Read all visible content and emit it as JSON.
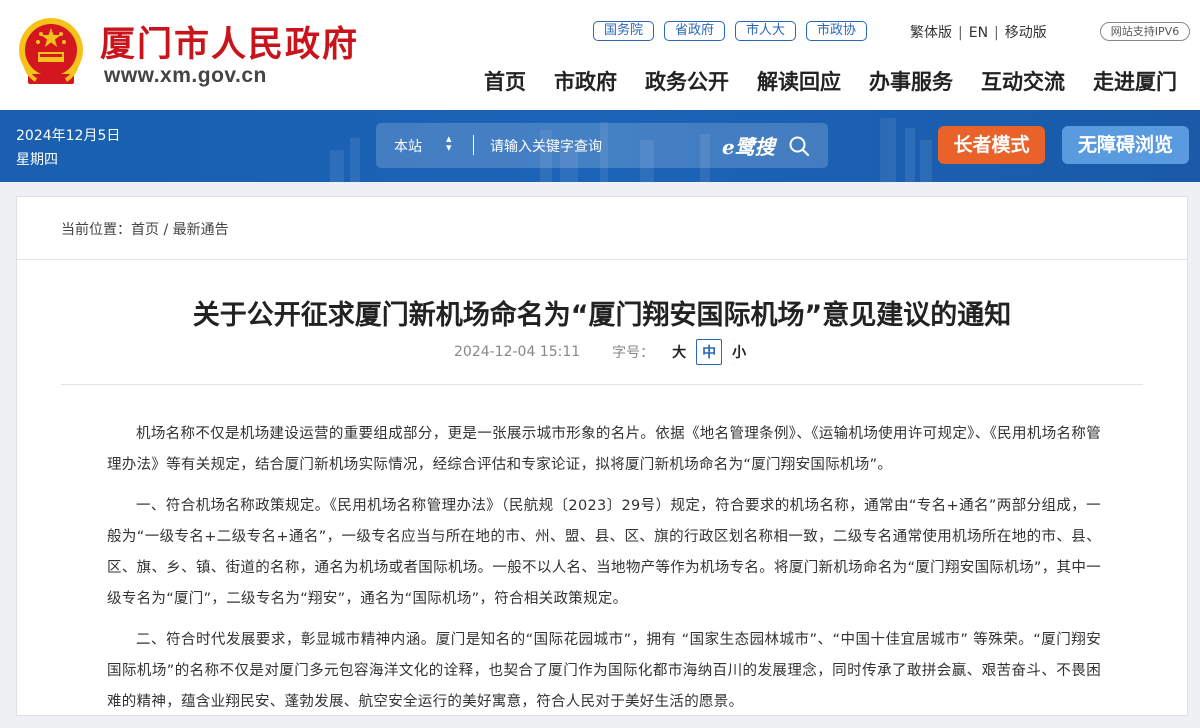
{
  "header": {
    "site_name": "厦门市人民政府",
    "site_url": "www.xm.gov.cn",
    "gov_links": [
      "国务院",
      "省政府",
      "市人大",
      "市政协"
    ],
    "lang_links": [
      "繁体版",
      "EN",
      "移动版"
    ],
    "ipv6": "网站支持IPV6",
    "nav": [
      "首页",
      "市政府",
      "政务公开",
      "解读回应",
      "办事服务",
      "互动交流",
      "走进厦门"
    ]
  },
  "banner": {
    "date": "2024年12月5日",
    "weekday": "星期四",
    "search": {
      "scope": "本站",
      "placeholder": "请输入关键字查询",
      "brand": "e鹭搜"
    },
    "elder_mode": "长者模式",
    "accessible": "无障碍浏览"
  },
  "breadcrumb": {
    "label": "当前位置：",
    "home": "首页",
    "sep": "/",
    "current": "最新通告"
  },
  "article": {
    "title": "关于公开征求厦门新机场命名为“厦门翔安国际机场”意见建议的通知",
    "datetime": "2024-12-04 15:11",
    "font_size_label": "字号：",
    "font_sizes": [
      "大",
      "中",
      "小"
    ],
    "paragraphs": [
      "机场名称不仅是机场建设运营的重要组成部分，更是一张展示城市形象的名片。依据《地名管理条例》、《运输机场使用许可规定》、《民用机场名称管理办法》等有关规定，结合厦门新机场实际情况，经综合评估和专家论证，拟将厦门新机场命名为“厦门翔安国际机场”。",
      "一、符合机场名称政策规定。《民用机场名称管理办法》（民航规〔2023〕29号）规定，符合要求的机场名称，通常由“专名+通名”两部分组成，一般为“一级专名+二级专名+通名”，一级专名应当与所在地的市、州、盟、县、区、旗的行政区划名称相一致，二级专名通常使用机场所在地的市、县、区、旗、乡、镇、街道的名称，通名为机场或者国际机场。一般不以人名、当地物产等作为机场专名。将厦门新机场命名为“厦门翔安国际机场”，其中一级专名为“厦门”，二级专名为“翔安”，通名为“国际机场”，符合相关政策规定。",
      "二、符合时代发展要求，彰显城市精神内涵。厦门是知名的“国际花园城市”，拥有 “国家生态园林城市”、“中国十佳宜居城市” 等殊荣。“厦门翔安国际机场”的名称不仅是对厦门多元包容海洋文化的诠释，也契合了厦门作为国际化都市海纳百川的发展理念，同时传承了敢拼会赢、艰苦奋斗、不畏困难的精神，蕴含业翔民安、蓬勃发展、航空安全运行的美好寓意，符合人民对于美好生活的愿景。"
    ]
  },
  "colors": {
    "brand_red": "#c8141a",
    "banner_blue": "#1c64b8",
    "elder_orange": "#e8622a",
    "access_blue": "#5a9be0",
    "link_blue": "#2b67b8"
  }
}
